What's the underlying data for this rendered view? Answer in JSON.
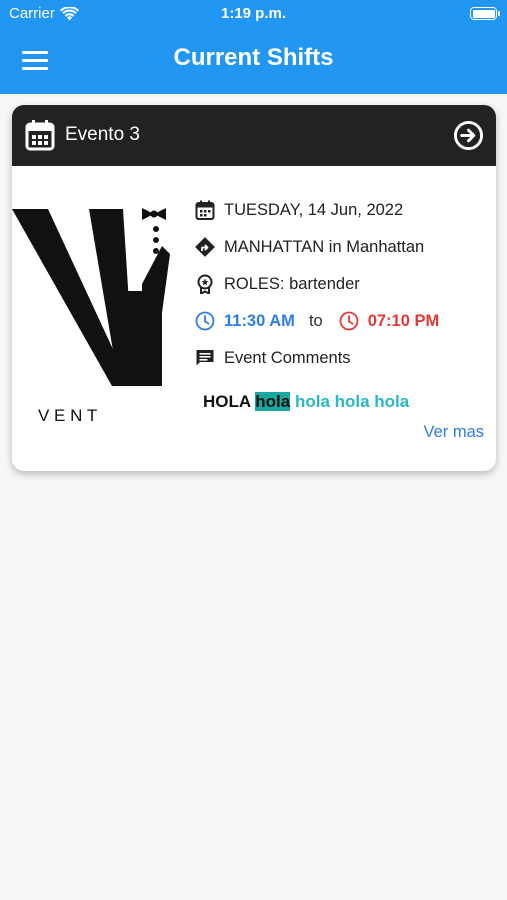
{
  "status_bar": {
    "carrier": "Carrier",
    "time": "1:19 p.m."
  },
  "app_bar": {
    "title": "Current Shifts"
  },
  "shift": {
    "event_name": "Evento 3",
    "logo_text": "V E N T",
    "date": "TUESDAY, 14 Jun, 2022",
    "location": "MANHATTAN in Manhattan",
    "roles": "ROLES: bartender",
    "start_time": "11:30 AM",
    "to_text": "to",
    "end_time": "07:10 PM",
    "comments_label": "Event Comments",
    "comment_parts": [
      "HOLA",
      "hola",
      "hola hola hola"
    ],
    "ver_mas": "Ver mas"
  },
  "colors": {
    "app_bar": "#2196f3",
    "card_header": "#222222",
    "start_time": "#2d7de6",
    "end_time": "#e53935",
    "comment_highlight": "#1aa7a0",
    "comment_teal": "#2ab7c8"
  },
  "icons": {
    "menu": "hamburger-menu-icon",
    "event": "calendar-icon",
    "open": "arrow-circle-right-icon",
    "date": "calendar-small-icon",
    "location": "directions-icon",
    "roles": "badge-icon",
    "start": "clock-icon",
    "end": "clock-icon",
    "comments": "comment-icon"
  }
}
